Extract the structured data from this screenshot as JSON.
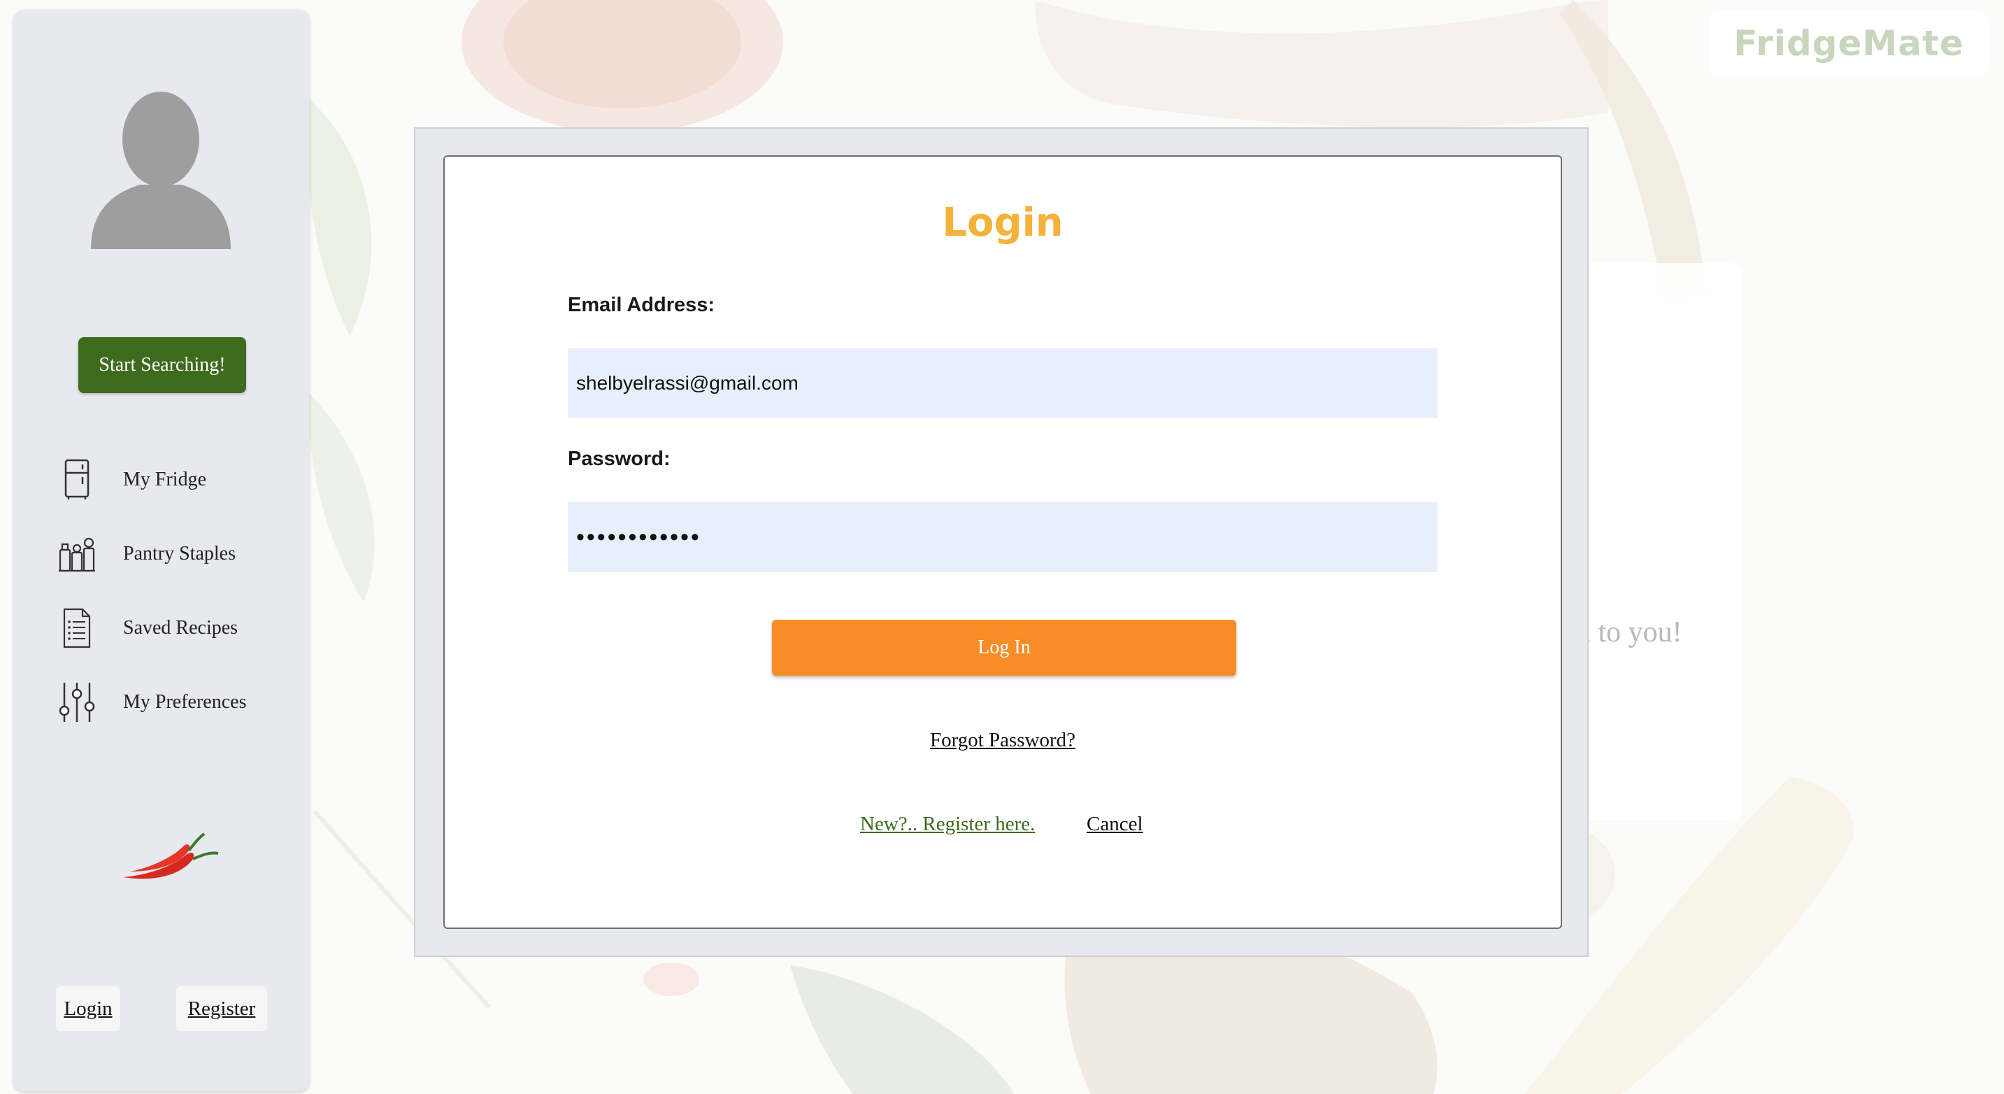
{
  "brand": {
    "name": "FridgeMate",
    "color": "#c9d6be"
  },
  "sidebar": {
    "start_button": "Start Searching!",
    "items": [
      {
        "label": "My Fridge",
        "icon": "fridge-icon"
      },
      {
        "label": "Pantry Staples",
        "icon": "pantry-jars-icon"
      },
      {
        "label": "Saved Recipes",
        "icon": "recipe-list-icon"
      },
      {
        "label": "My Preferences",
        "icon": "sliders-icon"
      }
    ],
    "login_link": "Login",
    "register_link": "Register",
    "avatar_icon": "user-avatar-icon",
    "decor_icon": "chili-pepper-icon"
  },
  "background": {
    "card_text": "d to you!"
  },
  "login_modal": {
    "title": "Login",
    "email_label": "Email Address:",
    "email_value": "shelbyelrassi@gmail.com",
    "password_label": "Password:",
    "password_value": "••••••••••••",
    "login_button": "Log In",
    "forgot_password": "Forgot Password?",
    "register_link": "New?.. Register here.",
    "cancel_link": "Cancel"
  },
  "colors": {
    "title": "#f4b23a",
    "login_button": "#f68d27",
    "start_button": "#3d6b1d",
    "input_bg": "#e8effc"
  }
}
